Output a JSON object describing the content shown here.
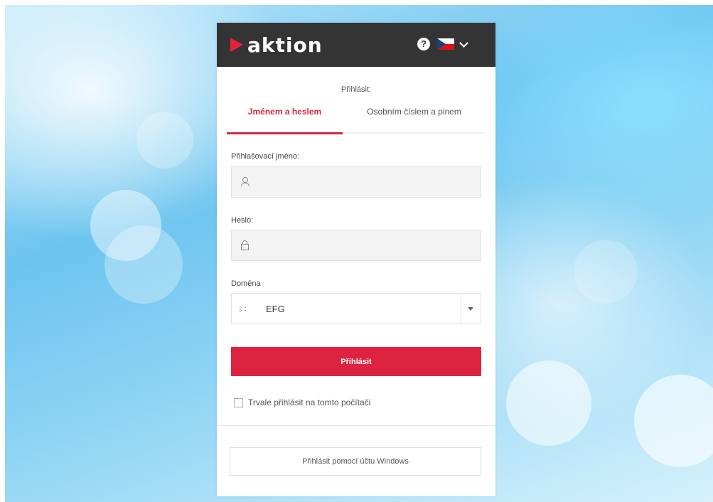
{
  "header": {
    "logo_text": "aktion",
    "help_symbol": "?",
    "language_flag": "cz-flag-icon",
    "accent_color": "#e8203b",
    "bar_color": "#343434"
  },
  "login": {
    "caption": "Přihlásit:",
    "tabs": [
      {
        "label": "Jménem a heslem",
        "active": true
      },
      {
        "label": "Osobním číslem a pinem",
        "active": false
      }
    ],
    "username_label": "Přihlašovací jméno:",
    "username_value": "",
    "password_label": "Heslo:",
    "password_value": "",
    "domain_label": "Doména",
    "domain_value": "EFG",
    "domain_icon": "⁝∷",
    "submit_label": "Přihlásit",
    "remember_label": "Trvale přihlásit na tomto počítači",
    "remember_checked": false,
    "windows_login_label": "Přihlásit pomocí účtu Windows"
  }
}
